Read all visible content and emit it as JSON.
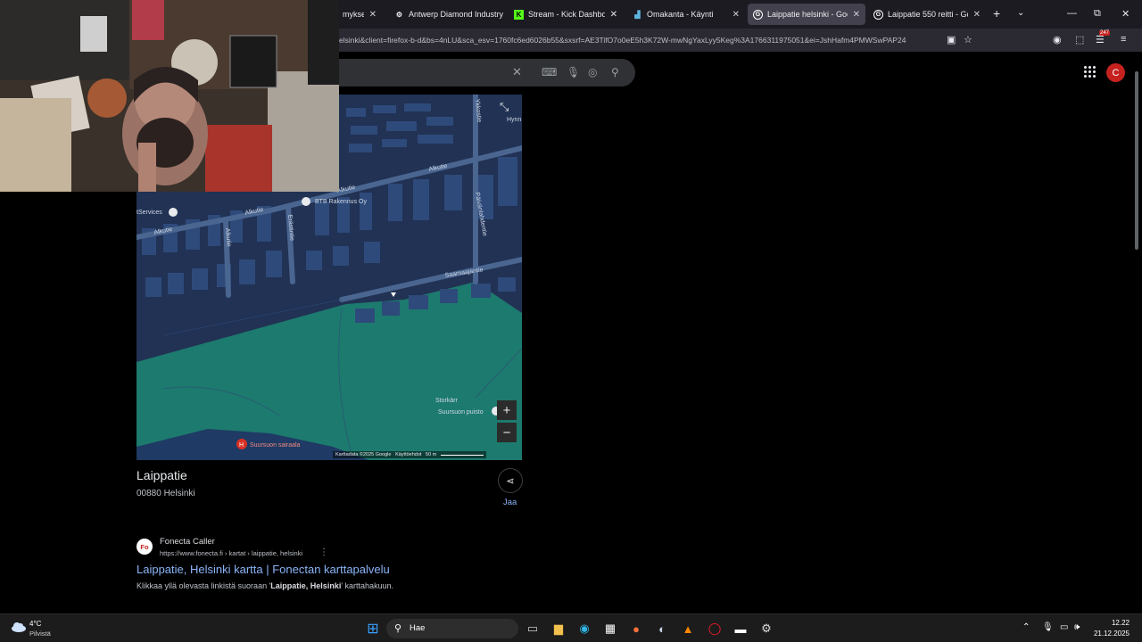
{
  "browser": {
    "tabs": [
      {
        "label": "mykset hi",
        "icon": "partial-tab-icon",
        "active": false
      },
      {
        "label": "Antwerp Diamond Industry",
        "icon": "gear-favicon-icon",
        "active": false
      },
      {
        "label": "Stream - Kick Dashboard",
        "icon": "kick-favicon-icon",
        "active": false
      },
      {
        "label": "Omakanta - Käynti",
        "icon": "omakanta-favicon-icon",
        "active": false
      },
      {
        "label": "Laippatie helsinki - Google",
        "icon": "google-favicon-icon",
        "active": true
      },
      {
        "label": "Laippatie 550 reitti - Google",
        "icon": "google-favicon-icon",
        "active": false
      }
    ],
    "url": "elsinki&client=firefox-b-d&bs=4nLU&sca_esv=1760fc6ed6026b55&sxsrf=AE3TifO7o0eE5h3K72W-mwNgYaxLyy5Keg%3A1766311975051&ei=JshHafm4PMWSwPAP24"
  },
  "map": {
    "labels": {
      "alkutie_1": "Alkutie",
      "alkutie_2": "Alkutie",
      "alkutie_3": "Alkutie",
      "alkutie_4": "Alkutie",
      "alkutie_v": "Alkutie",
      "erasitie": "Erästintie",
      "paivantie": "Päivänlahdentie",
      "saarnaajantie": "Saarnaajantie",
      "ykkostie": "Ykkostie",
      "hynn": "Hynn",
      "services": "tServices",
      "btb": "BTB Rakennus Oy",
      "storkarr": "Storkärr",
      "puisto": "Suursuon puisto",
      "hospital": "Suursuon sairaala",
      "hospital_letter": "H"
    },
    "attribution": {
      "data": "Karttadata ©2025 Google",
      "terms": "Käyttöehdot",
      "scale": "50 m"
    },
    "zoom_in": "+",
    "zoom_out": "−"
  },
  "place": {
    "name": "Laippatie",
    "address": "00880 Helsinki",
    "share_label": "Jaa"
  },
  "result": {
    "favicon_text": "Fo",
    "site": "Fonecta Caller",
    "url": "https://www.fonecta.fi › kartat › laippatie, helsinki",
    "more": "⋮",
    "title": "Laippatie, Helsinki kartta | Fonectan karttapalvelu",
    "snippet_pre": "Klikkaa yllä olevasta linkistä suoraan '",
    "snippet_bold": "Laippatie, Helsinki",
    "snippet_post": "' karttahakuun."
  },
  "account": {
    "initial": "C"
  },
  "extension_badge": "247",
  "taskbar": {
    "weather_temp": "4°C",
    "weather_desc": "Pilvistä",
    "search_label": "Hae",
    "time": "12.22",
    "date": "21.12.2025"
  },
  "colors": {
    "map_buildings": "#2e4a7a",
    "map_water": "#1d7a6e",
    "link": "#8ab4f8"
  }
}
